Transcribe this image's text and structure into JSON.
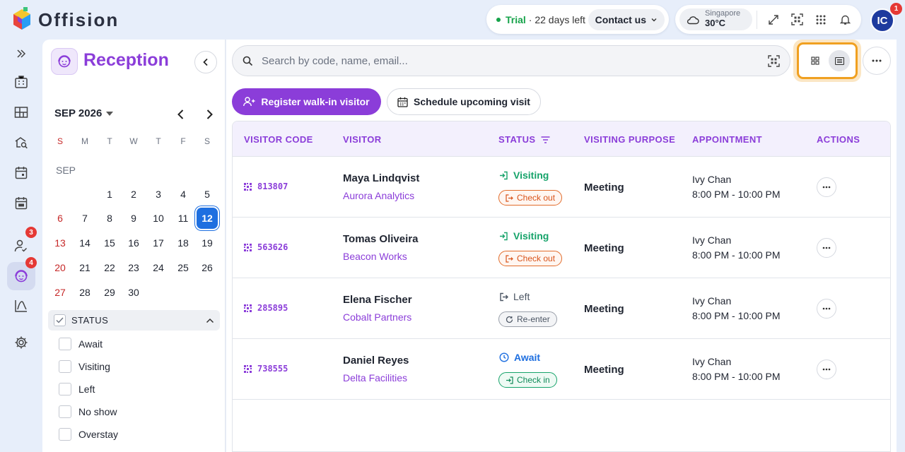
{
  "app": {
    "name": "Offision"
  },
  "header": {
    "trial_label": "Trial",
    "trial_days": "· 22 days left",
    "contact_label": "Contact us",
    "weather_city": "Singapore",
    "weather_temp": "30°C",
    "avatar_initials": "IC",
    "notification_count": "1"
  },
  "rail": {
    "badges": {
      "visitors": "3",
      "reception": "4"
    }
  },
  "side": {
    "title": "Reception",
    "month_label": "SEP 2026",
    "weekdays": [
      "S",
      "M",
      "T",
      "W",
      "T",
      "F",
      "S"
    ],
    "month_short": "SEP",
    "days": [
      "1",
      "2",
      "3",
      "4",
      "5",
      "6",
      "7",
      "8",
      "9",
      "10",
      "11",
      "12",
      "13",
      "14",
      "15",
      "16",
      "17",
      "18",
      "19",
      "20",
      "21",
      "22",
      "23",
      "24",
      "25",
      "26",
      "27",
      "28",
      "29",
      "30"
    ],
    "selected_day": "12",
    "status_title": "STATUS",
    "status_filters": [
      "Await",
      "Visiting",
      "Left",
      "No show",
      "Overstay"
    ]
  },
  "main": {
    "search_placeholder": "Search by code, name, email...",
    "register_label": "Register walk-in visitor",
    "schedule_label": "Schedule upcoming visit",
    "columns": [
      "VISITOR CODE",
      "VISITOR",
      "STATUS",
      "VISITING PURPOSE",
      "APPOINTMENT",
      "ACTIONS"
    ],
    "rows": [
      {
        "code": "813807",
        "name": "Maya Lindqvist",
        "company": "Aurora Analytics",
        "status": "Visiting",
        "action": "Check out",
        "purpose": "Meeting",
        "host": "Ivy Chan",
        "time": "8:00 PM - 10:00 PM"
      },
      {
        "code": "563626",
        "name": "Tomas Oliveira",
        "company": "Beacon Works",
        "status": "Visiting",
        "action": "Check out",
        "purpose": "Meeting",
        "host": "Ivy Chan",
        "time": "8:00 PM - 10:00 PM"
      },
      {
        "code": "285895",
        "name": "Elena Fischer",
        "company": "Cobalt Partners",
        "status": "Left",
        "action": "Re-enter",
        "purpose": "Meeting",
        "host": "Ivy Chan",
        "time": "8:00 PM - 10:00 PM"
      },
      {
        "code": "738555",
        "name": "Daniel Reyes",
        "company": "Delta Facilities",
        "status": "Await",
        "action": "Check in",
        "purpose": "Meeting",
        "host": "Ivy Chan",
        "time": "8:00 PM - 10:00 PM"
      }
    ]
  },
  "colors": {
    "brand": "#8b3dd9",
    "selected_day": "#1e6fe0",
    "visiting": "#16a36a",
    "checkout": "#e26c2b",
    "highlight": "#f0a020"
  }
}
